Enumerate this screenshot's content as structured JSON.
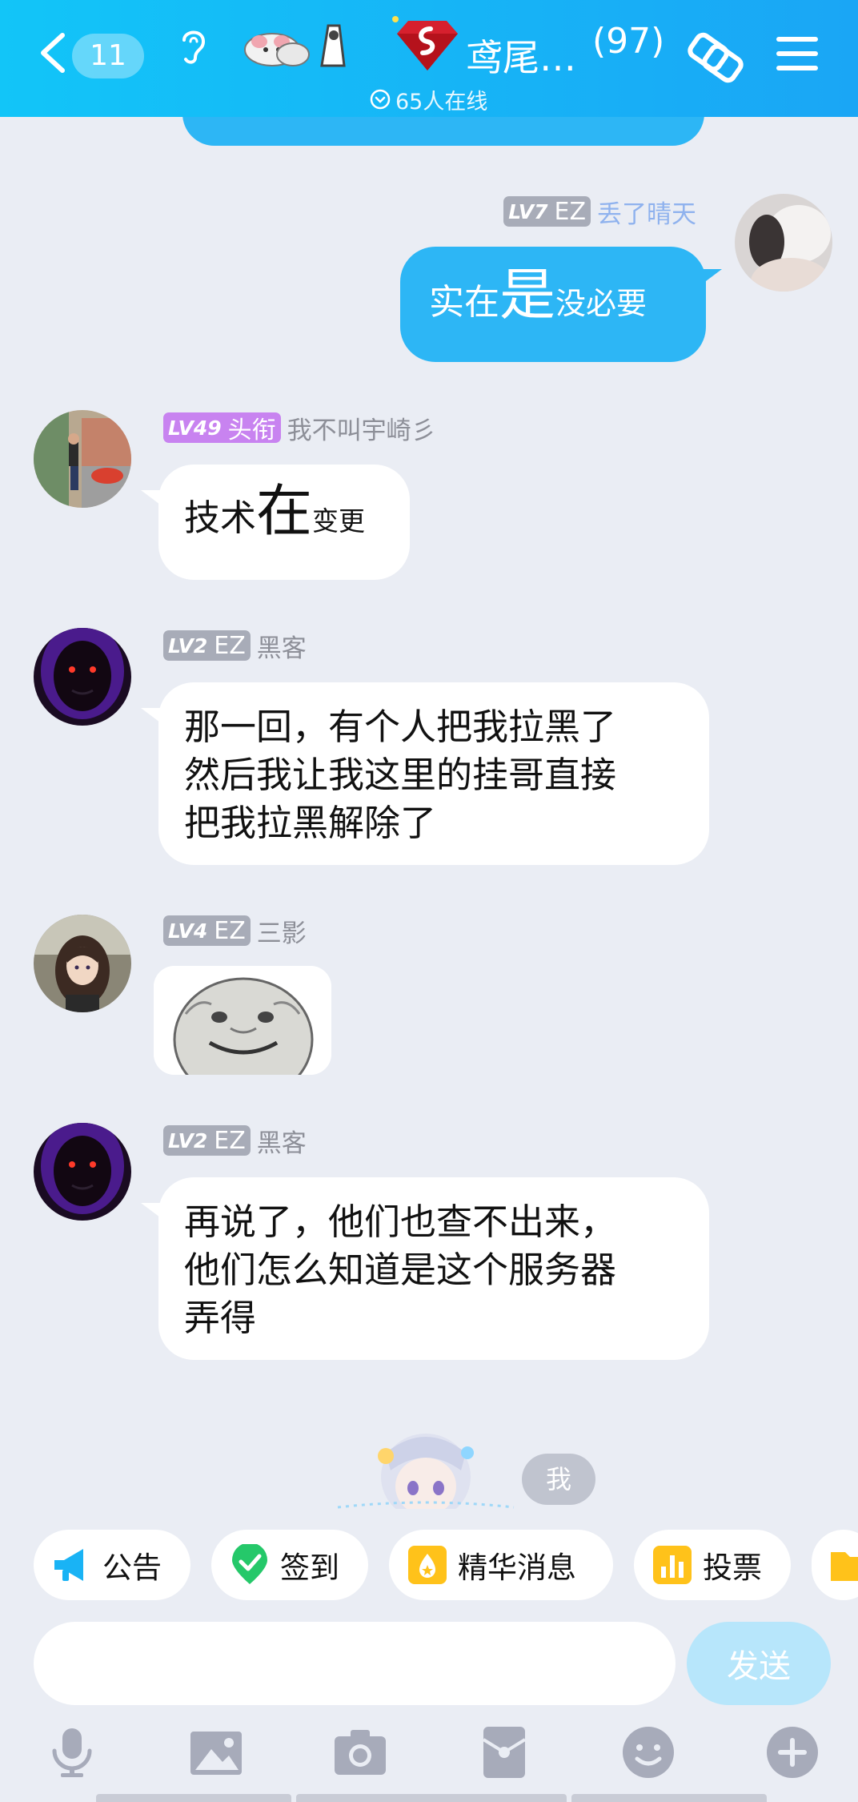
{
  "header": {
    "unread_count": "11",
    "group_name": "鸢尾…",
    "member_count": "(97)",
    "online_text": "65人在线"
  },
  "messages": [
    {
      "level": "LV7",
      "title": "EZ",
      "user": "丢了晴天",
      "side": "right",
      "parts": [
        "实在",
        "是",
        "没必要"
      ]
    },
    {
      "level": "LV49",
      "title": "头衔",
      "user": "我不叫宇崎彡",
      "side": "left",
      "parts": [
        "技术",
        "在",
        "变更"
      ]
    },
    {
      "level": "LV2",
      "title": "EZ",
      "user": "黑客",
      "side": "left",
      "lines": [
        "那一回，有个人把我拉黑了",
        "然后我让我这里的挂哥直接",
        "把我拉黑解除了"
      ]
    },
    {
      "level": "LV4",
      "title": "EZ",
      "user": "三影",
      "side": "left",
      "sticker": "meme-face-sticker"
    },
    {
      "level": "LV2",
      "title": "EZ",
      "user": "黑客",
      "side": "left",
      "lines": [
        "再说了，他们也查不出来，",
        "他们怎么知道是这个服务器",
        "弄得"
      ]
    }
  ],
  "me_label": "我",
  "quick_actions": [
    {
      "label": "公告",
      "icon": "megaphone-icon"
    },
    {
      "label": "签到",
      "icon": "checkin-icon"
    },
    {
      "label": "精华消息",
      "icon": "essence-icon"
    },
    {
      "label": "投票",
      "icon": "vote-icon"
    }
  ],
  "input": {
    "placeholder": "",
    "send_label": "发送"
  },
  "toolbar": [
    "microphone-icon",
    "image-icon",
    "camera-icon",
    "red-packet-icon",
    "emoji-icon",
    "plus-icon"
  ],
  "colors": {
    "header": "#12c5f8",
    "bubble_self": "#2db6f5",
    "background": "#eaedf4",
    "badge_gray": "#a8acb8",
    "badge_purple": "#c883f0",
    "send_disabled": "#b7e6fb"
  }
}
